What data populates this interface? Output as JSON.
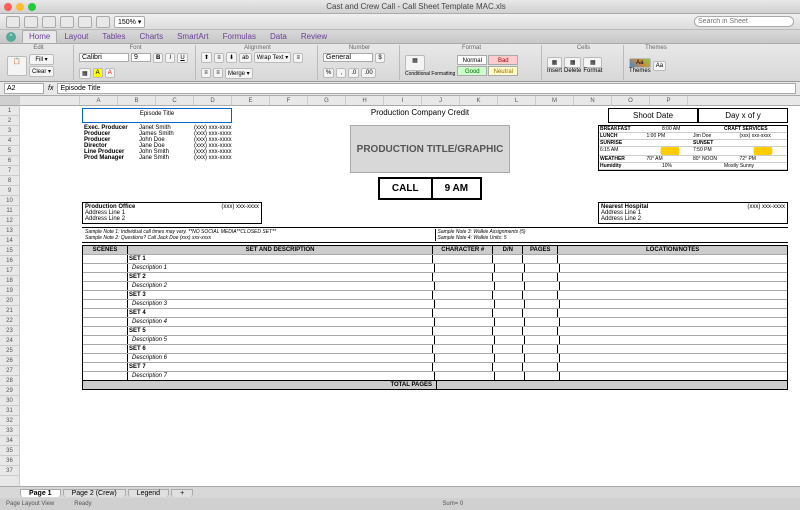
{
  "window": {
    "title": "Cast and Crew Call - Call Sheet Template MAC.xls"
  },
  "toolbar": {
    "zoom": "150% ▾",
    "search_ph": "Search in Sheet"
  },
  "ribbon": {
    "tabs": [
      "Home",
      "Layout",
      "Tables",
      "Charts",
      "SmartArt",
      "Formulas",
      "Data",
      "Review"
    ],
    "groups": {
      "edit": "Edit",
      "font": "Font",
      "alignment": "Alignment",
      "number": "Number",
      "format": "Format",
      "cells": "Cells",
      "themes": "Themes"
    },
    "fill": "Fill ▾",
    "clear": "Clear ▾",
    "font_name": "Calibri",
    "font_size": "9",
    "wrap": "Wrap Text ▾",
    "merge": "Merge ▾",
    "num_fmt": "General",
    "cond": "Conditional Formatting",
    "cf": {
      "normal": "Normal",
      "bad": "Bad",
      "good": "Good",
      "neutral": "Neutral"
    },
    "insert": "Insert",
    "delete": "Delete",
    "format_btn": "Format",
    "themes": "Themes",
    "aa": "Aa"
  },
  "fbar": {
    "cell": "A2",
    "fx": "fx",
    "formula": "Episode Title"
  },
  "cols": [
    "A",
    "B",
    "C",
    "D",
    "E",
    "F",
    "G",
    "H",
    "I",
    "J",
    "K",
    "L",
    "M",
    "N",
    "O",
    "P"
  ],
  "rows": 37,
  "sheet": {
    "episode": "Episode Title",
    "credit": "Production Company Credit",
    "shootdate": "Shoot Date",
    "dayxy": "Day x of y",
    "crew": [
      {
        "role": "Exec. Producer",
        "name": "Janet Smith",
        "ph": "(xxx) xxx-xxxx"
      },
      {
        "role": "Producer",
        "name": "James Smith",
        "ph": "(xxx) xxx-xxxx"
      },
      {
        "role": "Producer",
        "name": "John Doe",
        "ph": "(xxx) xxx-xxxx"
      },
      {
        "role": "Director",
        "name": "Jane Doe",
        "ph": "(xxx) xxx-xxxx"
      },
      {
        "role": "Line Producer",
        "name": "John Smith",
        "ph": "(xxx) xxx-xxxx"
      },
      {
        "role": "Prod Manager",
        "name": "Jane Smith",
        "ph": "(xxx) xxx-xxxx"
      }
    ],
    "logo": "PRODUCTION TITLE/GRAPHIC",
    "call_label": "CALL",
    "call_time": "9 AM",
    "info": {
      "breakfast": "BREAKFAST",
      "breakfast_t": "8:00 AM",
      "craft": "CRAFT SERVICES",
      "lunch": "LUNCH",
      "lunch_t": "1:00 PM",
      "lunch_p": "Jim Doe",
      "lunch_ph": "(xxx) xxx-xxxx",
      "sunrise": "SUNRISE",
      "sunset": "SUNSET",
      "sunrise_t": "6:15 AM",
      "sunset_t": "7:50 PM",
      "weather": "WEATHER",
      "w_am": "70° AM",
      "w_noon": "80° NOON",
      "w_pm": "72° PM",
      "humidity": "Humidity",
      "hum_v": "10%",
      "cond": "Mostly Sunny"
    },
    "prod_office": {
      "title": "Production Office",
      "l1": "Address Line 1",
      "l2": "Address Line 2",
      "ph": "(xxx) xxx-xxxx"
    },
    "hospital": {
      "title": "Nearest Hospital",
      "l1": "Address Line 1",
      "l2": "Address Line 2",
      "ph": "(xxx) xxx-xxxx"
    },
    "notes": {
      "n1": "Sample Note 1: Individual call times may vary. **NO SOCIAL MEDIA**CLOSED SET**",
      "n2": "Sample Note 2: Questions?  Call Jack Doe (xxx) xxx-xxxx",
      "n3": "Sample Note 3: Walkie Assignments (5)",
      "n4": "Sample Note 4: Walkie Units: 5"
    },
    "table": {
      "h_scenes": "SCENES",
      "h_set": "SET AND DESCRIPTION",
      "h_char": "CHARACTER #",
      "h_dn": "D/N",
      "h_pages": "PAGES",
      "h_loc": "LOCATION/NOTES",
      "rows": [
        {
          "set": "SET 1",
          "desc": "Description 1"
        },
        {
          "set": "SET 2",
          "desc": "Description 2"
        },
        {
          "set": "SET 3",
          "desc": "Description 3"
        },
        {
          "set": "SET 4",
          "desc": "Description 4"
        },
        {
          "set": "SET 5",
          "desc": "Description 5"
        },
        {
          "set": "SET 6",
          "desc": "Description 6"
        },
        {
          "set": "SET 7",
          "desc": "Description 7"
        }
      ],
      "total": "TOTAL PAGES"
    }
  },
  "sheet_tabs": [
    "Page 1",
    "Page 2 (Crew)",
    "Legend",
    "+"
  ],
  "status": {
    "view": "Page Layout View",
    "ready": "Ready",
    "sum": "Sum= 0"
  }
}
